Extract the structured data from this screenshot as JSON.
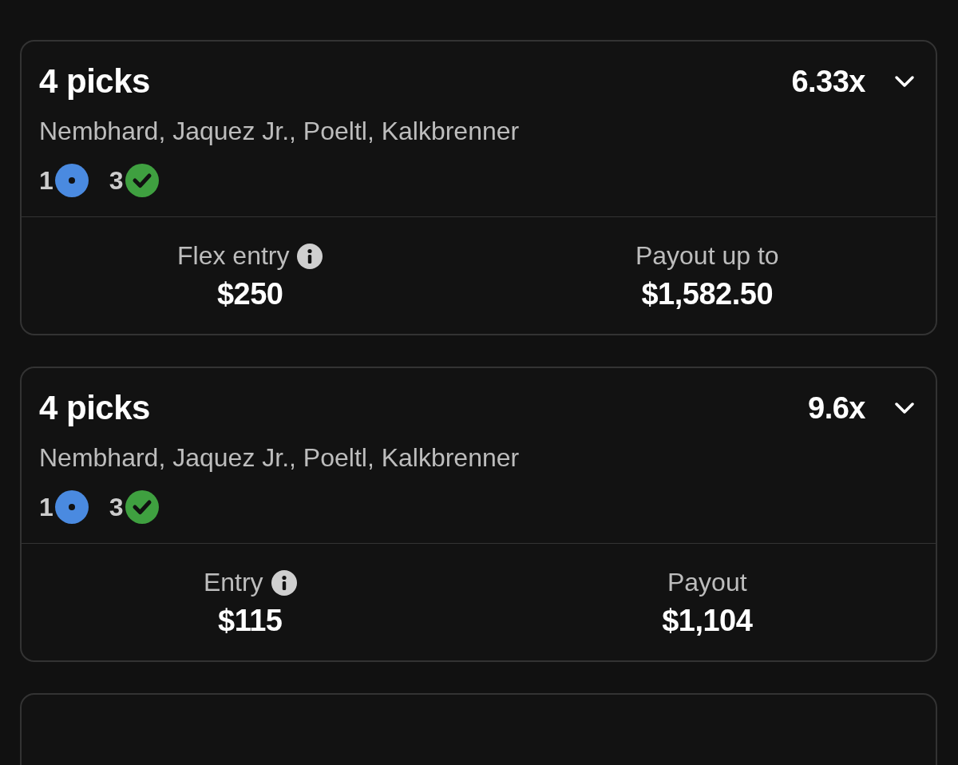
{
  "entries": [
    {
      "title": "4 picks",
      "multiplier": "6.33x",
      "expanded": false,
      "players": "Nembhard, Jaquez Jr., Poeltl, Kalkbrenner",
      "statuses": [
        {
          "kind": "pending",
          "count": "1"
        },
        {
          "kind": "won",
          "count": "3"
        }
      ],
      "entry_label": "Flex entry",
      "entry_amount": "$250",
      "payout_label": "Payout up to",
      "payout_amount": "$1,582.50"
    },
    {
      "title": "4 picks",
      "multiplier": "9.6x",
      "expanded": false,
      "players": "Nembhard, Jaquez Jr., Poeltl, Kalkbrenner",
      "statuses": [
        {
          "kind": "pending",
          "count": "1"
        },
        {
          "kind": "won",
          "count": "3"
        }
      ],
      "entry_label": "Entry",
      "entry_amount": "$115",
      "payout_label": "Payout",
      "payout_amount": "$1,104"
    }
  ]
}
